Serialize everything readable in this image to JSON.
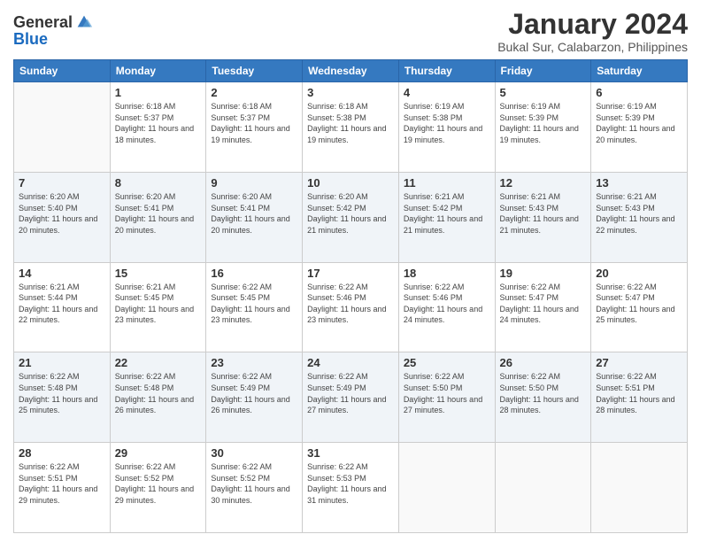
{
  "logo": {
    "general": "General",
    "blue": "Blue"
  },
  "header": {
    "month": "January 2024",
    "location": "Bukal Sur, Calabarzon, Philippines"
  },
  "weekdays": [
    "Sunday",
    "Monday",
    "Tuesday",
    "Wednesday",
    "Thursday",
    "Friday",
    "Saturday"
  ],
  "weeks": [
    [
      {
        "day": "",
        "empty": true
      },
      {
        "day": "1",
        "sunrise": "6:18 AM",
        "sunset": "5:37 PM",
        "daylight": "11 hours and 18 minutes."
      },
      {
        "day": "2",
        "sunrise": "6:18 AM",
        "sunset": "5:37 PM",
        "daylight": "11 hours and 19 minutes."
      },
      {
        "day": "3",
        "sunrise": "6:18 AM",
        "sunset": "5:38 PM",
        "daylight": "11 hours and 19 minutes."
      },
      {
        "day": "4",
        "sunrise": "6:19 AM",
        "sunset": "5:38 PM",
        "daylight": "11 hours and 19 minutes."
      },
      {
        "day": "5",
        "sunrise": "6:19 AM",
        "sunset": "5:39 PM",
        "daylight": "11 hours and 19 minutes."
      },
      {
        "day": "6",
        "sunrise": "6:19 AM",
        "sunset": "5:39 PM",
        "daylight": "11 hours and 20 minutes."
      }
    ],
    [
      {
        "day": "7",
        "sunrise": "6:20 AM",
        "sunset": "5:40 PM",
        "daylight": "11 hours and 20 minutes."
      },
      {
        "day": "8",
        "sunrise": "6:20 AM",
        "sunset": "5:41 PM",
        "daylight": "11 hours and 20 minutes."
      },
      {
        "day": "9",
        "sunrise": "6:20 AM",
        "sunset": "5:41 PM",
        "daylight": "11 hours and 20 minutes."
      },
      {
        "day": "10",
        "sunrise": "6:20 AM",
        "sunset": "5:42 PM",
        "daylight": "11 hours and 21 minutes."
      },
      {
        "day": "11",
        "sunrise": "6:21 AM",
        "sunset": "5:42 PM",
        "daylight": "11 hours and 21 minutes."
      },
      {
        "day": "12",
        "sunrise": "6:21 AM",
        "sunset": "5:43 PM",
        "daylight": "11 hours and 21 minutes."
      },
      {
        "day": "13",
        "sunrise": "6:21 AM",
        "sunset": "5:43 PM",
        "daylight": "11 hours and 22 minutes."
      }
    ],
    [
      {
        "day": "14",
        "sunrise": "6:21 AM",
        "sunset": "5:44 PM",
        "daylight": "11 hours and 22 minutes."
      },
      {
        "day": "15",
        "sunrise": "6:21 AM",
        "sunset": "5:45 PM",
        "daylight": "11 hours and 23 minutes."
      },
      {
        "day": "16",
        "sunrise": "6:22 AM",
        "sunset": "5:45 PM",
        "daylight": "11 hours and 23 minutes."
      },
      {
        "day": "17",
        "sunrise": "6:22 AM",
        "sunset": "5:46 PM",
        "daylight": "11 hours and 23 minutes."
      },
      {
        "day": "18",
        "sunrise": "6:22 AM",
        "sunset": "5:46 PM",
        "daylight": "11 hours and 24 minutes."
      },
      {
        "day": "19",
        "sunrise": "6:22 AM",
        "sunset": "5:47 PM",
        "daylight": "11 hours and 24 minutes."
      },
      {
        "day": "20",
        "sunrise": "6:22 AM",
        "sunset": "5:47 PM",
        "daylight": "11 hours and 25 minutes."
      }
    ],
    [
      {
        "day": "21",
        "sunrise": "6:22 AM",
        "sunset": "5:48 PM",
        "daylight": "11 hours and 25 minutes."
      },
      {
        "day": "22",
        "sunrise": "6:22 AM",
        "sunset": "5:48 PM",
        "daylight": "11 hours and 26 minutes."
      },
      {
        "day": "23",
        "sunrise": "6:22 AM",
        "sunset": "5:49 PM",
        "daylight": "11 hours and 26 minutes."
      },
      {
        "day": "24",
        "sunrise": "6:22 AM",
        "sunset": "5:49 PM",
        "daylight": "11 hours and 27 minutes."
      },
      {
        "day": "25",
        "sunrise": "6:22 AM",
        "sunset": "5:50 PM",
        "daylight": "11 hours and 27 minutes."
      },
      {
        "day": "26",
        "sunrise": "6:22 AM",
        "sunset": "5:50 PM",
        "daylight": "11 hours and 28 minutes."
      },
      {
        "day": "27",
        "sunrise": "6:22 AM",
        "sunset": "5:51 PM",
        "daylight": "11 hours and 28 minutes."
      }
    ],
    [
      {
        "day": "28",
        "sunrise": "6:22 AM",
        "sunset": "5:51 PM",
        "daylight": "11 hours and 29 minutes."
      },
      {
        "day": "29",
        "sunrise": "6:22 AM",
        "sunset": "5:52 PM",
        "daylight": "11 hours and 29 minutes."
      },
      {
        "day": "30",
        "sunrise": "6:22 AM",
        "sunset": "5:52 PM",
        "daylight": "11 hours and 30 minutes."
      },
      {
        "day": "31",
        "sunrise": "6:22 AM",
        "sunset": "5:53 PM",
        "daylight": "11 hours and 31 minutes."
      },
      {
        "day": "",
        "empty": true
      },
      {
        "day": "",
        "empty": true
      },
      {
        "day": "",
        "empty": true
      }
    ]
  ]
}
